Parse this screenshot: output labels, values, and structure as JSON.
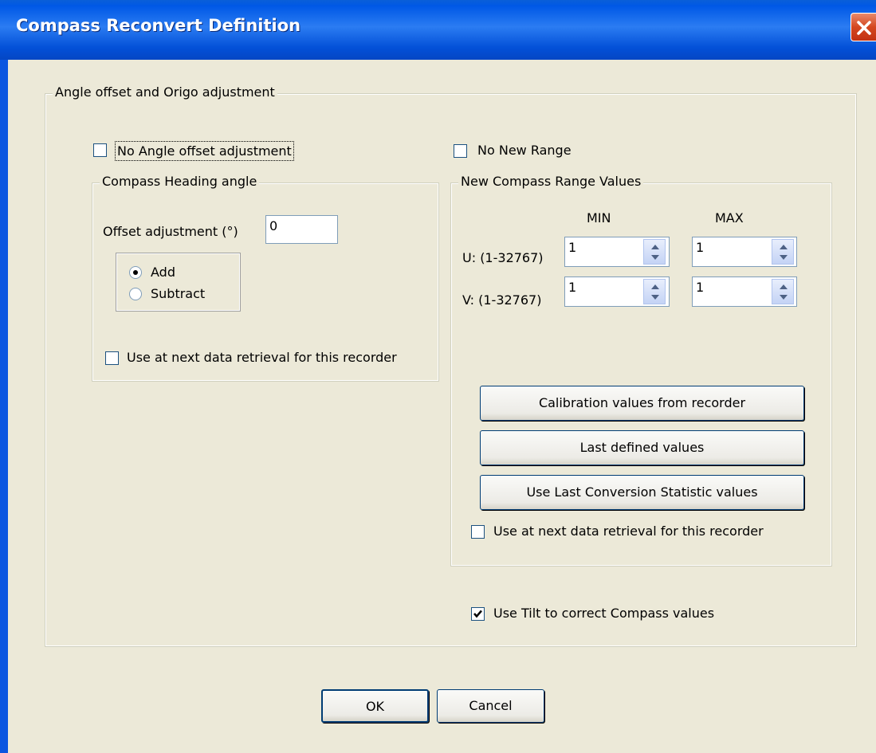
{
  "window": {
    "title": "Compass Reconvert Definition"
  },
  "main_group": {
    "legend": "Angle offset and Origo adjustment"
  },
  "angle": {
    "no_offset_label": "No Angle offset adjustment",
    "no_offset_checked": false,
    "heading_group_legend": "Compass Heading angle",
    "offset_label": "Offset adjustment (°)",
    "offset_value": "0",
    "add_label": "Add",
    "subtract_label": "Subtract",
    "selected": "Add",
    "use_next_label": "Use at next data retrieval for this recorder",
    "use_next_checked": false
  },
  "range": {
    "no_new_range_label": "No New Range",
    "no_new_range_checked": false,
    "group_legend": "New Compass Range Values",
    "min_header": "MIN",
    "max_header": "MAX",
    "u_label": "U: (1-32767)",
    "v_label": "V: (1-32767)",
    "u_min": "1",
    "u_max": "1",
    "v_min": "1",
    "v_max": "1",
    "calibration_button": "Calibration values from recorder",
    "last_defined_button": "Last defined values",
    "last_conversion_button": "Use Last Conversion Statistic values",
    "use_next_label": "Use at next data retrieval for this recorder",
    "use_next_checked": false
  },
  "tilt": {
    "label": "Use Tilt to correct Compass values",
    "checked": true
  },
  "footer": {
    "ok_label": "OK",
    "cancel_label": "Cancel"
  }
}
